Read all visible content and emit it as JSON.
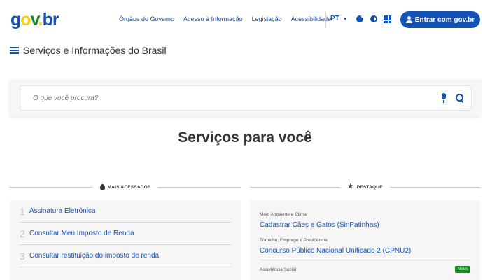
{
  "header": {
    "logo": {
      "g": "g",
      "o": "o",
      "v": "v",
      "dot": ".",
      "br": "br"
    },
    "links": [
      "Órgãos do Governo",
      "Acesso à Informação",
      "Legislação",
      "Acessibilidade"
    ],
    "language": "PT",
    "icons": [
      "cookie-icon",
      "contrast-icon",
      "apps-grid-icon"
    ],
    "login_label": "Entrar com gov.br"
  },
  "site": {
    "title": "Serviços e Informações do Brasil"
  },
  "search": {
    "placeholder": "O que você procura?"
  },
  "main": {
    "heading": "Serviços para você"
  },
  "most_accessed": {
    "label": "MAIS ACESSADOS",
    "items": [
      {
        "rank": "1",
        "label": "Assinatura Eletrônica"
      },
      {
        "rank": "2",
        "label": "Consultar Meu Imposto de Renda"
      },
      {
        "rank": "3",
        "label": "Consultar restituição do imposto de renda"
      }
    ]
  },
  "highlights": {
    "label": "DESTAQUE",
    "items": [
      {
        "category": "Meio Ambiente e Clima",
        "title": "Cadastrar Cães e Gatos (SinPatinhas)"
      },
      {
        "category": "Trabalho, Emprego e Previdência",
        "title": "Concurso Público Nacional Unificado 2 (CPNU2)"
      }
    ],
    "next_category": "Assistência Social",
    "badge": "Novo"
  },
  "colors": {
    "primary": "#1351b4",
    "yellow": "#ffcd07",
    "green": "#168821",
    "card_bg": "#f6f6f6"
  }
}
